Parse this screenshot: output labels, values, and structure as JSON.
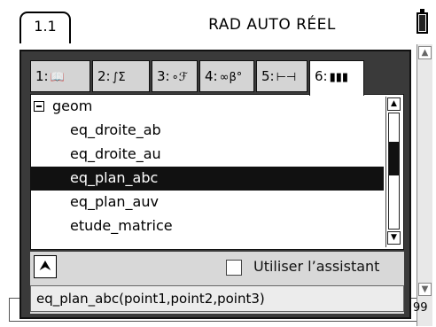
{
  "topbar": {
    "tab_label": "1.1",
    "mode_text": "RAD AUTO RÉEL"
  },
  "catalog": {
    "tabs": [
      {
        "num": "1:",
        "glyph": "📖"
      },
      {
        "num": "2:",
        "glyph": "∫Σ"
      },
      {
        "num": "3:",
        "glyph": "∘ℱ"
      },
      {
        "num": "4:",
        "glyph": "∞β°"
      },
      {
        "num": "5:",
        "glyph": "⊢⊣"
      },
      {
        "num": "6:",
        "glyph": "▮▮▮"
      }
    ],
    "active_tab_index": 5,
    "group_name": "geom",
    "items": [
      "eq_droite_ab",
      "eq_droite_au",
      "eq_plan_abc",
      "eq_plan_auv",
      "etude_matrice"
    ],
    "selected_item": "eq_plan_abc",
    "assistant_label": "Utiliser l’assistant",
    "assistant_checked": false,
    "syntax": "eq_plan_abc(point1,point2,point3)"
  },
  "document": {
    "output_fragment": "99"
  }
}
